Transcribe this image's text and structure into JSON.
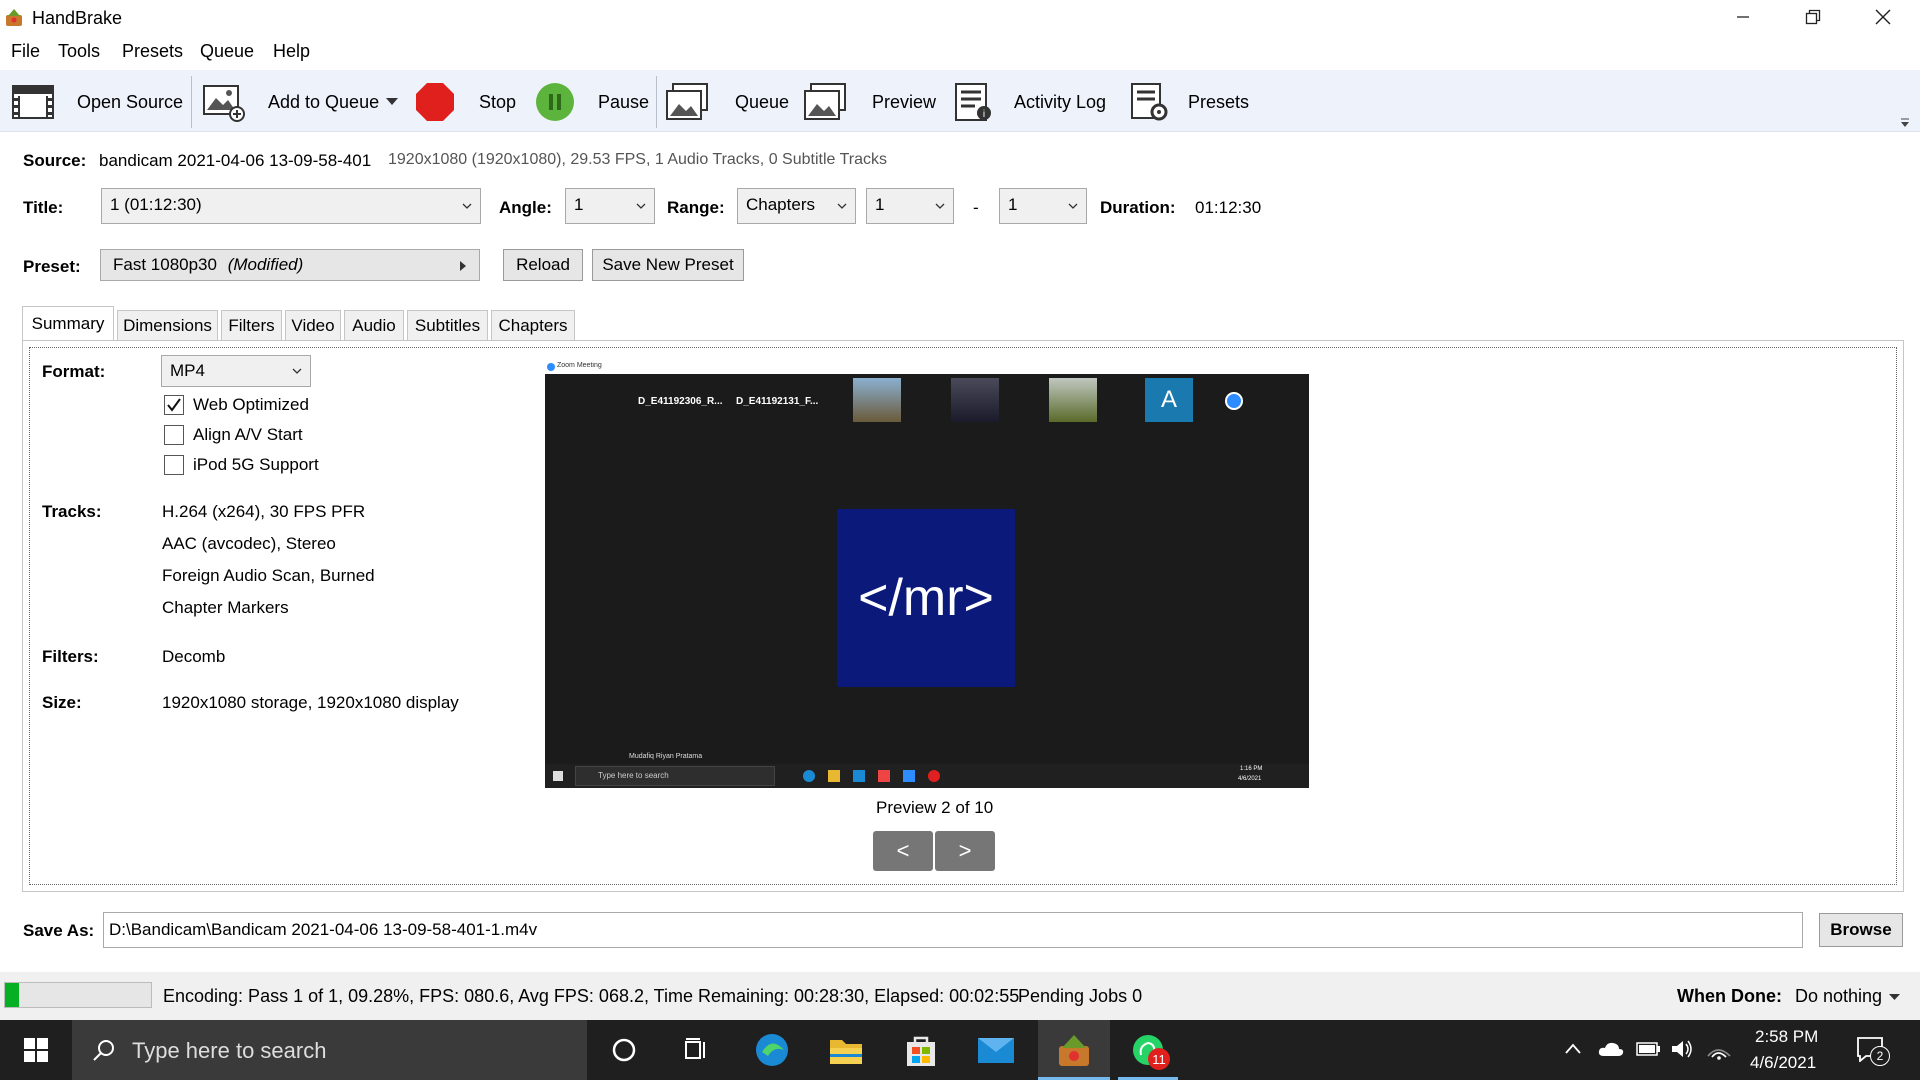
{
  "window": {
    "title": "HandBrake",
    "controls": [
      "minimize",
      "restore",
      "close"
    ]
  },
  "menu": [
    "File",
    "Tools",
    "Presets",
    "Queue",
    "Help"
  ],
  "toolbar": {
    "open_source": "Open Source",
    "add_to_queue": "Add to Queue",
    "stop": "Stop",
    "pause": "Pause",
    "queue": "Queue",
    "preview": "Preview",
    "activity_log": "Activity Log",
    "presets": "Presets"
  },
  "source": {
    "label": "Source:",
    "name": "bandicam 2021-04-06 13-09-58-401",
    "info": "1920x1080 (1920x1080), 29.53 FPS, 1 Audio Tracks, 0 Subtitle Tracks"
  },
  "title_row": {
    "title_label": "Title:",
    "title_value": "1 (01:12:30)",
    "angle_label": "Angle:",
    "angle_value": "1",
    "range_label": "Range:",
    "range_value": "Chapters",
    "range_start": "1",
    "range_dash": "-",
    "range_end": "1",
    "duration_label": "Duration:",
    "duration_value": "01:12:30"
  },
  "preset_row": {
    "label": "Preset:",
    "name": "Fast 1080p30",
    "modified": "(Modified)",
    "reload": "Reload",
    "save_new": "Save New Preset"
  },
  "tabs": [
    "Summary",
    "Dimensions",
    "Filters",
    "Video",
    "Audio",
    "Subtitles",
    "Chapters"
  ],
  "active_tab": "Summary",
  "summary": {
    "format_label": "Format:",
    "format_value": "MP4",
    "web_optimized": "Web Optimized",
    "web_optimized_checked": true,
    "align_av": "Align A/V Start",
    "align_av_checked": false,
    "ipod": "iPod 5G Support",
    "ipod_checked": false,
    "tracks_label": "Tracks:",
    "tracks": [
      "H.264 (x264), 30 FPS PFR",
      "AAC (avcodec), Stereo",
      "Foreign Audio Scan, Burned",
      "Chapter Markers"
    ],
    "filters_label": "Filters:",
    "filters_value": "Decomb",
    "size_label": "Size:",
    "size_value": "1920x1080 storage, 1920x1080 display"
  },
  "preview": {
    "window_title": "Zoom Meeting",
    "participants": [
      "D_E41192306_R...",
      "D_E41192131_F..."
    ],
    "avatar_letter": "A",
    "logo_text": "</mr>",
    "speaker": "Mudafiq Riyan Pratama",
    "taskbar_search": "Type here to search",
    "clock_time": "1:16 PM",
    "clock_date": "4/6/2021",
    "caption": "Preview 2 of 10",
    "prev": "<",
    "next": ">"
  },
  "save_as": {
    "label": "Save As:",
    "path": "D:\\Bandicam\\Bandicam 2021-04-06 13-09-58-401-1.m4v",
    "browse": "Browse"
  },
  "status": {
    "progress": 0.0928,
    "text": "Encoding: Pass 1 of 1,  09.28%, FPS: 080.6,  Avg FPS: 068.2,  Time Remaining: 00:28:30,  Elapsed: 00:02:55",
    "pending": "Pending Jobs 0",
    "when_done_label": "When Done:",
    "when_done_value": "Do nothing"
  },
  "taskbar": {
    "search_placeholder": "Type here to search",
    "time": "2:58 PM",
    "date": "4/6/2021",
    "whatsapp_badge": "11",
    "notification_count": "2"
  },
  "colors": {
    "toolbar_bg": "#eef3fb",
    "stop_red": "#e0201c",
    "pause_green": "#5cb43c",
    "progress_green": "#06b025",
    "taskbar_bg": "#1f1f1f",
    "preview_logo_bg": "#0b1a7a"
  }
}
